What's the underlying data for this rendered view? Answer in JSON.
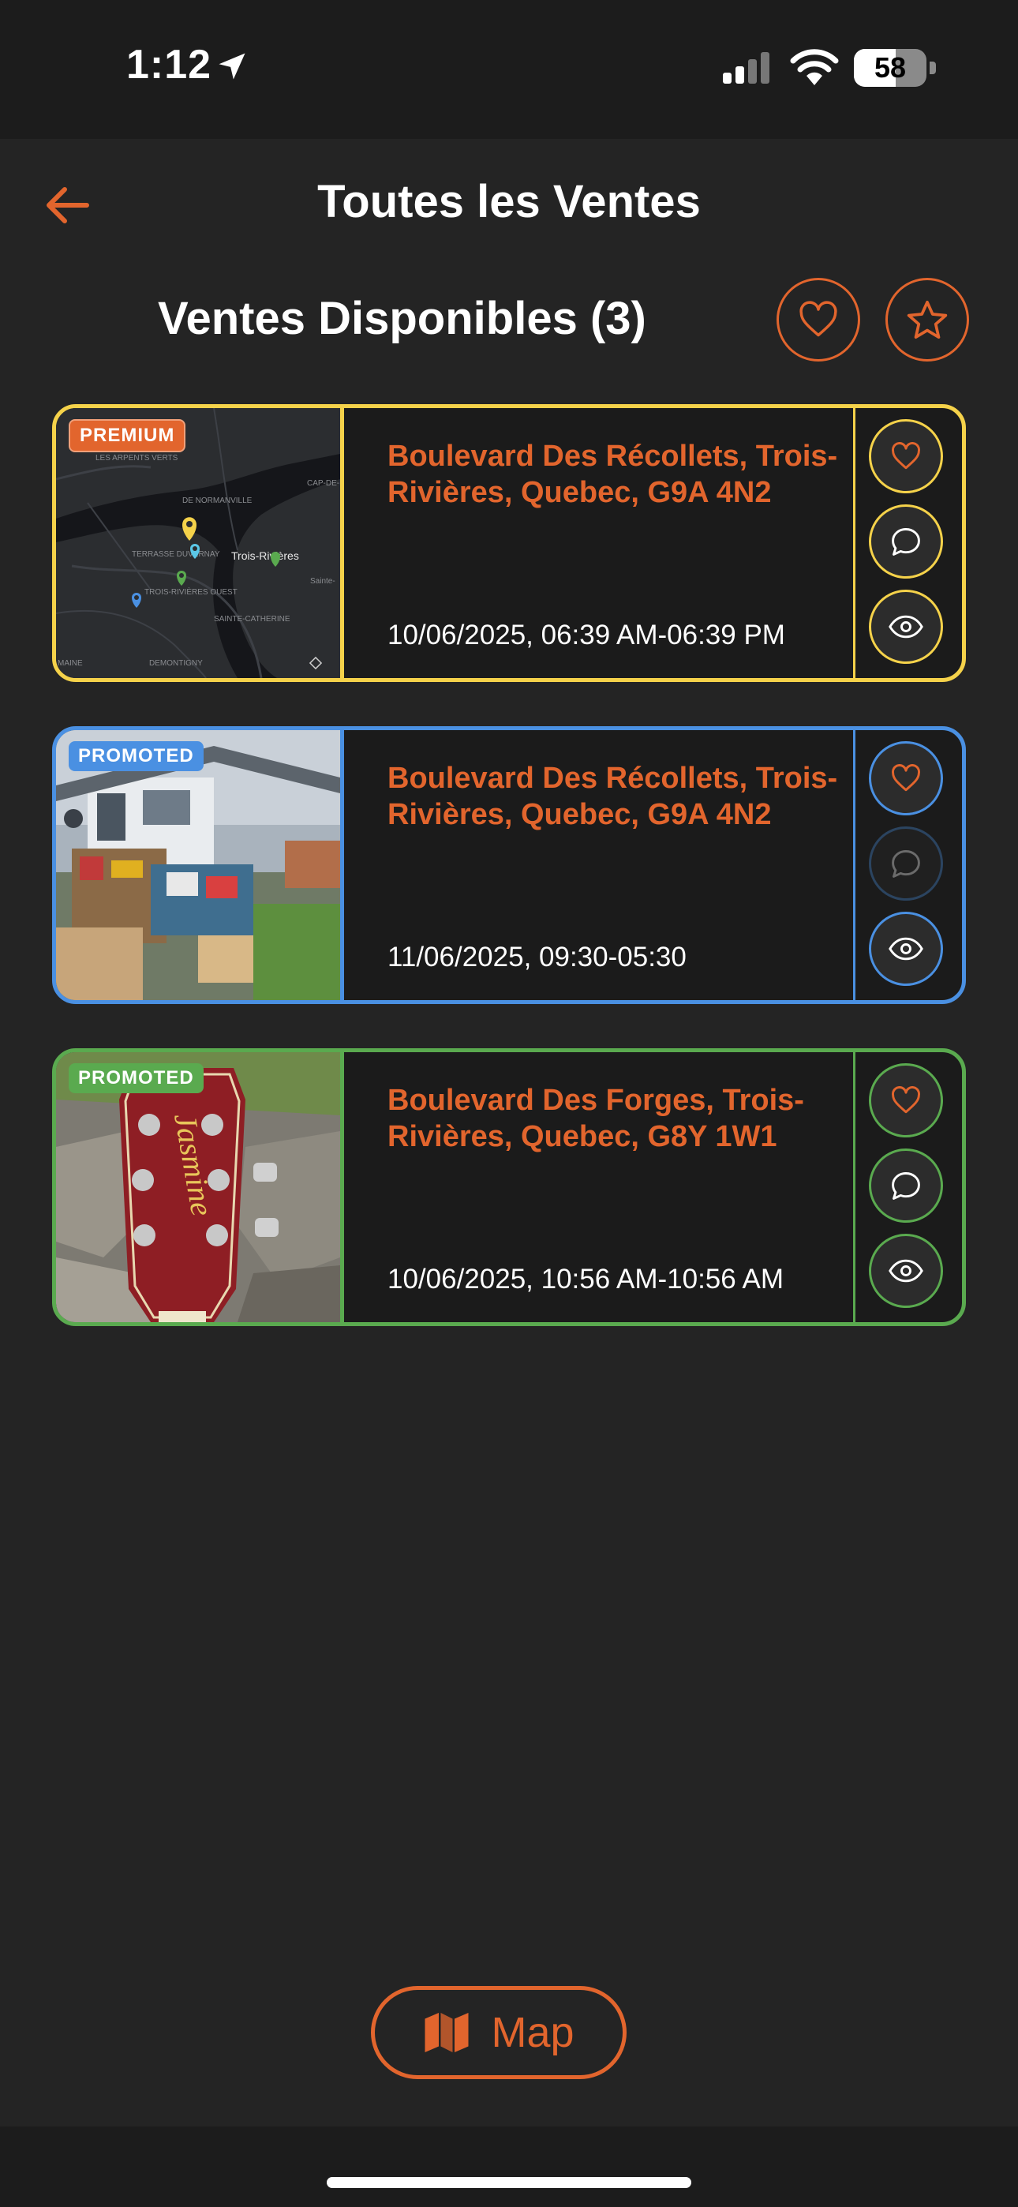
{
  "status_bar": {
    "time": "1:12",
    "battery": "58",
    "battery_level": 0.58
  },
  "header": {
    "title": "Toutes les Ventes",
    "back_icon": "arrow-left-icon"
  },
  "section": {
    "title": "Ventes Disponibles (3)",
    "favorites_icon": "heart-icon",
    "starred_icon": "star-icon"
  },
  "colors": {
    "accent": "#e2652d",
    "premium": "#f5d24a",
    "promoted_blue": "#4a90e2",
    "promoted_green": "#5aaa4f",
    "background": "#242424"
  },
  "sales": [
    {
      "badge": "PREMIUM",
      "address": "Boulevard Des Récollets, Trois-Rivières, Quebec, G9A 4N2",
      "date": "10/06/2025, 06:39 AM-06:39 PM",
      "image": "map-thumbnail",
      "map_labels": {
        "city": "Trois-Rivières",
        "labels": [
          "LES ARPENTS VERTS",
          "DE NORMANVILLE",
          "CAP-DE-LA-MADELEINE",
          "TERRASSE DUVERNAY",
          "TROIS-RIVIÈRES OUEST",
          "SAINTE-CATHERINE",
          "DEMONTIGNY",
          "Sainte-",
          "MAINE"
        ]
      },
      "chat_enabled": true
    },
    {
      "badge": "PROMOTED",
      "address": "Boulevard Des Récollets, Trois-Rivières, Quebec, G9A 4N2",
      "date": "11/06/2025, 09:30-05:30",
      "image": "garage-sale-photo",
      "chat_enabled": false
    },
    {
      "badge": "PROMOTED",
      "address": "Boulevard Des Forges, Trois-Rivières, Quebec, G8Y 1W1",
      "date": "10/06/2025, 10:56 AM-10:56 AM",
      "image": "guitar-headstock-photo",
      "guitar_brand": "Jasmine",
      "chat_enabled": true
    }
  ],
  "map_button": {
    "label": "Map",
    "icon": "map-icon"
  }
}
